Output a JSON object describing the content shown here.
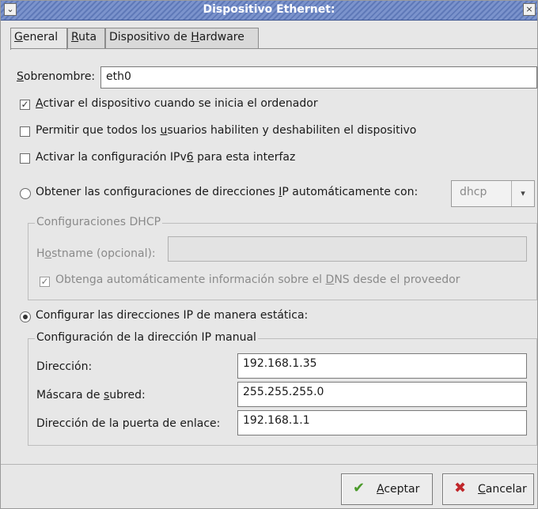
{
  "window": {
    "title": "Dispositivo Ethernet:",
    "menu_glyph": "⌄",
    "close_glyph": "×"
  },
  "tabs": [
    {
      "label": "General",
      "mnemonic": "G",
      "rest": "eneral"
    },
    {
      "label": "Ruta",
      "mnemonic": "R",
      "rest": "uta"
    },
    {
      "label": "Dispositivo de Hardware",
      "pre": "Dispositivo de ",
      "mnemonic": "H",
      "rest": "ardware"
    }
  ],
  "general": {
    "nickname_label_mn": "S",
    "nickname_label_rest": "obrenombre:",
    "nickname_value": "eth0",
    "checks": [
      {
        "checked": true,
        "mn": "A",
        "text": "ctivar el dispositivo cuando se inicia el ordenador",
        "pre": ""
      },
      {
        "checked": false,
        "pre": "Permitir que todos los ",
        "mn": "u",
        "text": "suarios habiliten y deshabiliten el dispositivo"
      },
      {
        "checked": false,
        "pre": "Activar la configuración IPv",
        "mn": "6",
        "text": " para esta interfaz"
      }
    ],
    "auto": {
      "selected": false,
      "pre": "Obtener las configuraciones de direcciones ",
      "mn": "I",
      "rest": "P automáticamente con:",
      "protocol": "dhcp",
      "combo_arrow": "▾"
    },
    "dhcp": {
      "legend": "Configuraciones DHCP",
      "hostname_pre": "H",
      "hostname_mn": "o",
      "hostname_rest": "stname (opcional):",
      "hostname_value": "",
      "dns_checked": true,
      "dns_pre": "Obtenga automáticamente información sobre el ",
      "dns_mn": "D",
      "dns_rest": "NS desde el proveedor"
    },
    "static": {
      "selected": true,
      "label": "Configurar las direcciones IP de manera estática:",
      "legend": "Configuración de la dirección IP manual",
      "address_label": "Dirección:",
      "address_value": "192.168.1.35",
      "netmask_pre": "Máscara de ",
      "netmask_mn": "s",
      "netmask_rest": "ubred:",
      "netmask_value": "255.255.255.0",
      "gateway_label": "Dirección de la puerta de enlace:",
      "gateway_value": "192.168.1.1"
    }
  },
  "buttons": {
    "ok_mn": "A",
    "ok_rest": "ceptar",
    "ok_icon": "✔",
    "cancel_mn": "C",
    "cancel_rest": "ancelar",
    "cancel_icon": "✖"
  },
  "colors": {
    "title_bar": "#6a84c2",
    "ok_icon": "#4a9a2a",
    "cancel_icon": "#c0262a"
  }
}
